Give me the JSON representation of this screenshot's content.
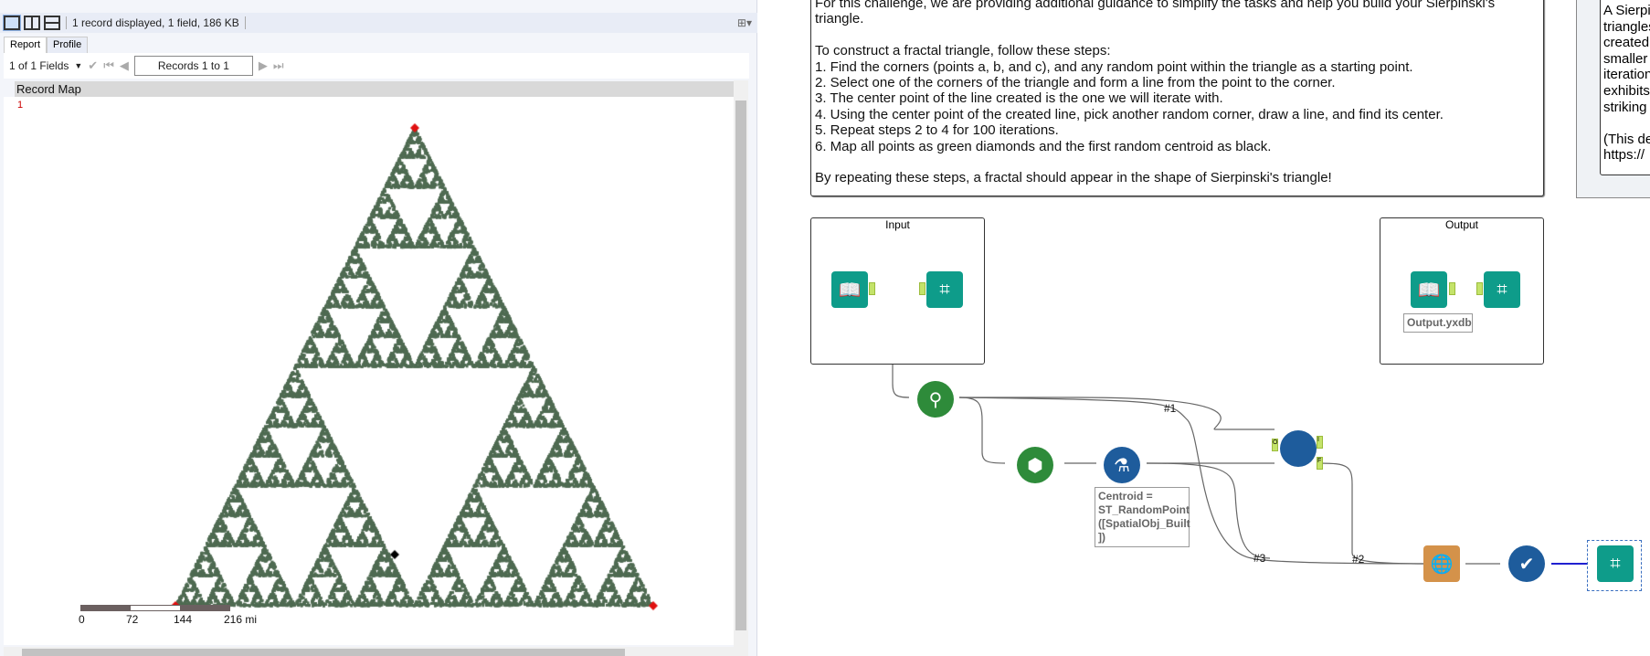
{
  "results": {
    "summary": "1 record displayed, 1 field, 186 KB",
    "tabs": [
      {
        "label": "Report"
      },
      {
        "label": "Profile"
      }
    ],
    "fields_label": "1 of 1 Fields",
    "records_label": "Records 1 to 1",
    "column_headers": [
      "Record",
      "Map"
    ],
    "row_number": "1",
    "scale_bar": {
      "ticks": [
        "0",
        "72",
        "144",
        "216 mi"
      ]
    },
    "colors": {
      "points": "#4f6b52",
      "corners": "#e01010",
      "start": "#000000"
    }
  },
  "canvas": {
    "instructions": [
      "For this challenge, we are providing additional guidance to simplify the tasks and help you build your Sierpinski's",
      "triangle.",
      "",
      "To construct a fractal triangle, follow these steps:",
      "1. Find the corners (points a, b, and c), and any random point within the triangle as a starting point.",
      "2. Select one of the corners of the triangle and form a line from the point to the corner.",
      "3. The center point of the line created is the one we will iterate with.",
      "4. Using the center point of the created line, pick another random corner, draw a line, and find its center.",
      "5. Repeat steps 2 to 4 for 100 iterations.",
      "6. Map all points as green diamonds and the first random centroid as black.",
      "",
      "By repeating these steps, a fractal should appear in the shape of Sierpinski's triangle!"
    ],
    "side_note": "A Sierpi\ntriangles\ncreated \nsmaller \niteration\nexhibits \nstriking \n\n(This de\nhttps://",
    "input_container": "Input",
    "output_container": "Output",
    "output_file": "Output.yxdb",
    "formula_note": "Centroid =\nST_RandomPoint\n([SpatialObj_Built\n])",
    "connection_labels": [
      "#1",
      "#3",
      "#2"
    ],
    "filter_anchors": [
      "O",
      "I",
      "F"
    ]
  }
}
